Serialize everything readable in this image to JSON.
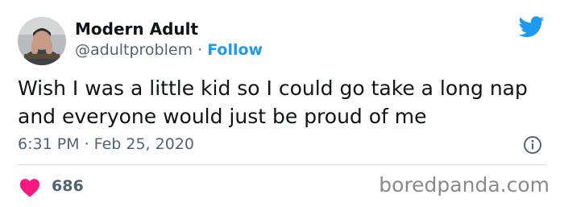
{
  "tweet": {
    "author": {
      "display_name": "Modern Adult",
      "handle": "@adultproblem",
      "separator": " · ",
      "follow_label": "Follow",
      "avatar_icon": "profile-photo"
    },
    "text": "Wish I was a little kid so I could go take a long nap and everyone would just be proud of me",
    "timestamp": "6:31 PM · Feb 25, 2020",
    "likes": "686",
    "icons": {
      "brand": "twitter-bird-icon",
      "info": "info-icon",
      "like": "heart-icon"
    }
  },
  "colors": {
    "twitter_blue": "#1d9bf0",
    "heart_red": "#f91880",
    "secondary_text": "#536471",
    "divider": "#cfd9de"
  },
  "watermark": "boredpanda.com"
}
